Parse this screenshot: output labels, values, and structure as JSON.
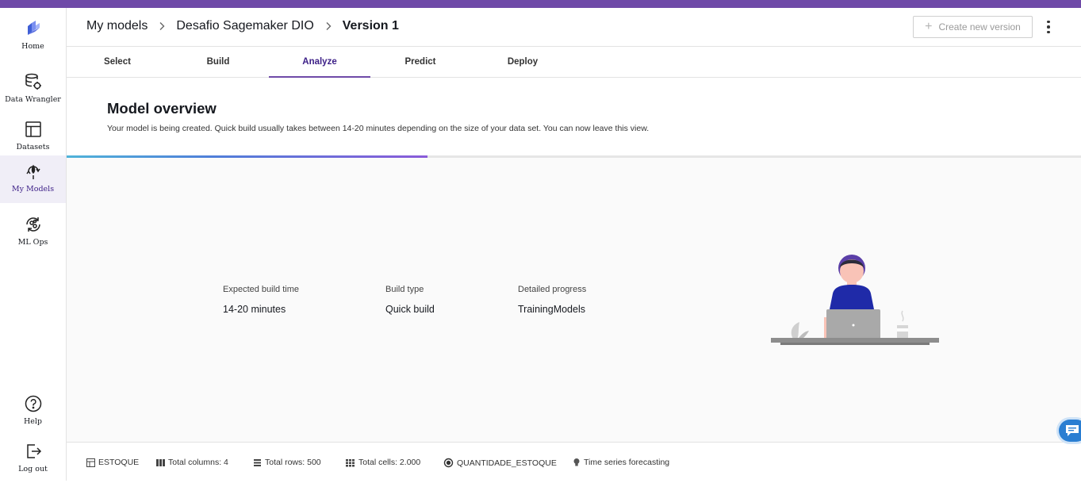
{
  "colors": {
    "accent": "#6f4aa8",
    "active_tab": "#3c1f87",
    "progress_start": "#4fb3d9",
    "progress_end": "#8a5bd9",
    "chat": "#2a7ed2"
  },
  "sidebar": {
    "items": [
      {
        "label": "Home",
        "icon": "home-logo-icon"
      },
      {
        "label": "Data Wrangler",
        "icon": "data-wrangler-icon"
      },
      {
        "label": "Datasets",
        "icon": "datasets-icon"
      },
      {
        "label": "My Models",
        "icon": "models-icon",
        "active": true
      },
      {
        "label": "ML Ops",
        "icon": "ml-ops-icon"
      }
    ],
    "bottom": [
      {
        "label": "Help",
        "icon": "help-icon"
      },
      {
        "label": "Log out",
        "icon": "logout-icon"
      }
    ]
  },
  "header": {
    "breadcrumb": [
      "My models",
      "Desafio Sagemaker DIO",
      "Version 1"
    ],
    "create_version_label": "Create new version"
  },
  "tabs": [
    "Select",
    "Build",
    "Analyze",
    "Predict",
    "Deploy"
  ],
  "active_tab": "Analyze",
  "overview": {
    "title": "Model overview",
    "description": "Your model is being created. Quick build usually takes between 14-20 minutes depending on the size of your data set. You can now leave this view."
  },
  "progress": 0.356,
  "stats": [
    {
      "label": "Expected build time",
      "value": "14-20 minutes"
    },
    {
      "label": "Build type",
      "value": "Quick build"
    },
    {
      "label": "Detailed progress",
      "value": "TrainingModels"
    }
  ],
  "footer": {
    "dataset": "ESTOQUE",
    "columns": "Total columns: 4",
    "rows": "Total rows: 500",
    "cells": "Total cells: 2.000",
    "target": "QUANTIDADE_ESTOQUE",
    "model_type": "Time series forecasting"
  }
}
